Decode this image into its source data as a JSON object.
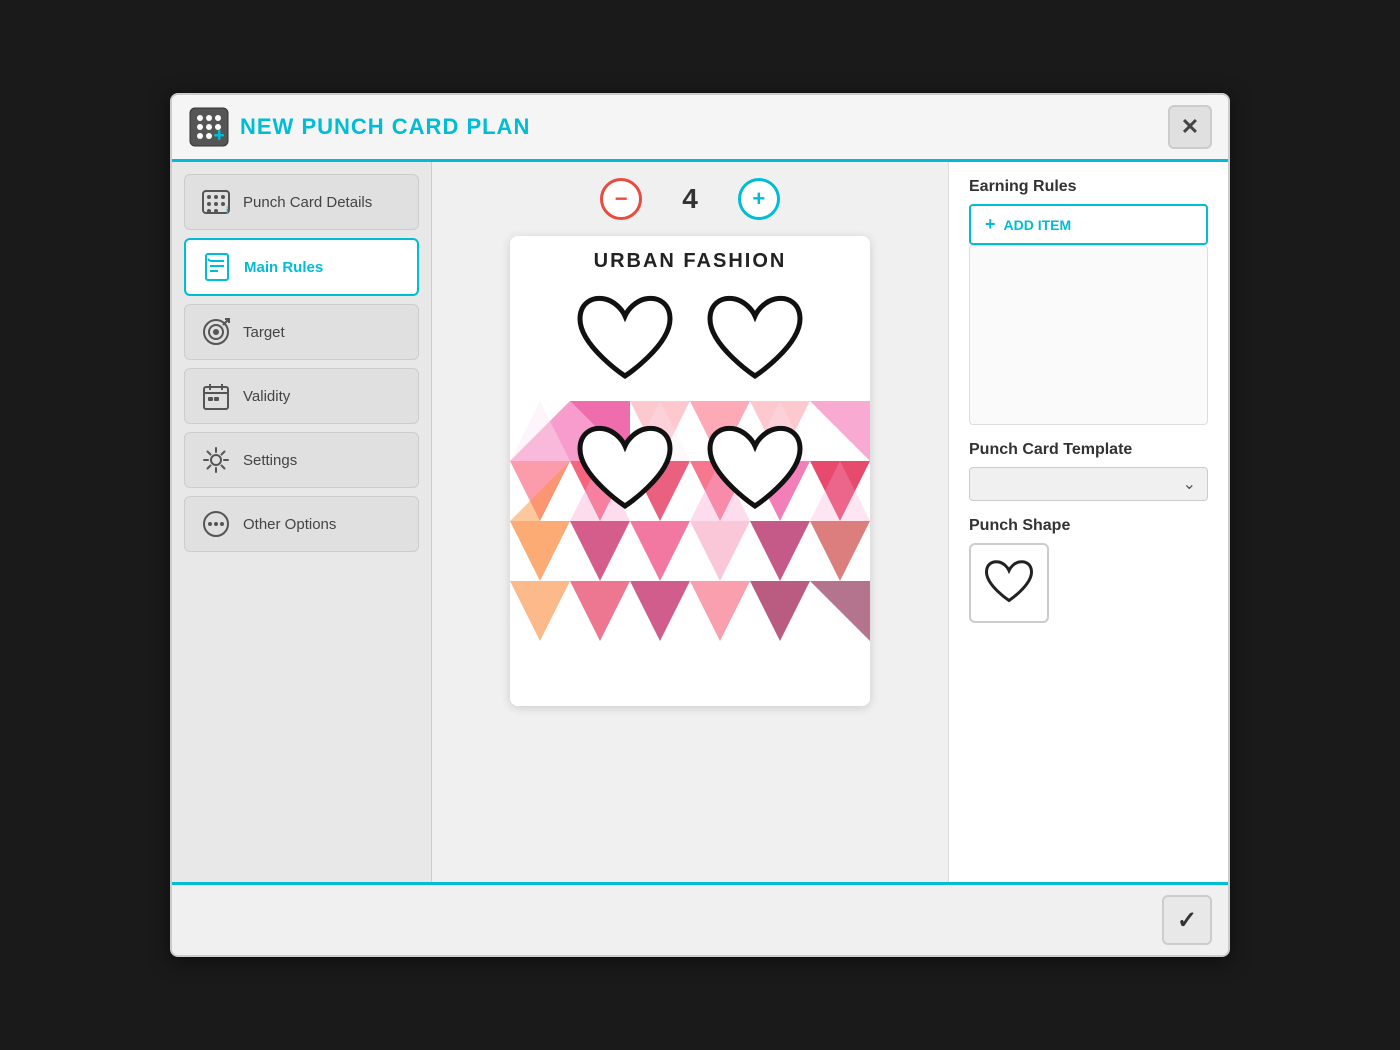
{
  "dialog": {
    "title": "NEW PUNCH CARD PLAN",
    "close_label": "✕"
  },
  "sidebar": {
    "items": [
      {
        "id": "punch-card-details",
        "label": "Punch Card Details",
        "active": false
      },
      {
        "id": "main-rules",
        "label": "Main Rules",
        "active": true
      },
      {
        "id": "target",
        "label": "Target",
        "active": false
      },
      {
        "id": "validity",
        "label": "Validity",
        "active": false
      },
      {
        "id": "settings",
        "label": "Settings",
        "active": false
      },
      {
        "id": "other-options",
        "label": "Other Options",
        "active": false
      }
    ]
  },
  "main": {
    "counter": {
      "value": "4",
      "minus_label": "−",
      "plus_label": "+"
    },
    "card": {
      "title": "URBAN FASHION"
    }
  },
  "right_panel": {
    "earning_rules_label": "Earning Rules",
    "add_item_label": "ADD ITEM",
    "template_label": "Punch Card Template",
    "template_placeholder": "",
    "punch_shape_label": "Punch Shape"
  },
  "footer": {
    "confirm_label": "✓"
  },
  "colors": {
    "accent": "#00bcd4",
    "active_border": "#00bcd4"
  }
}
